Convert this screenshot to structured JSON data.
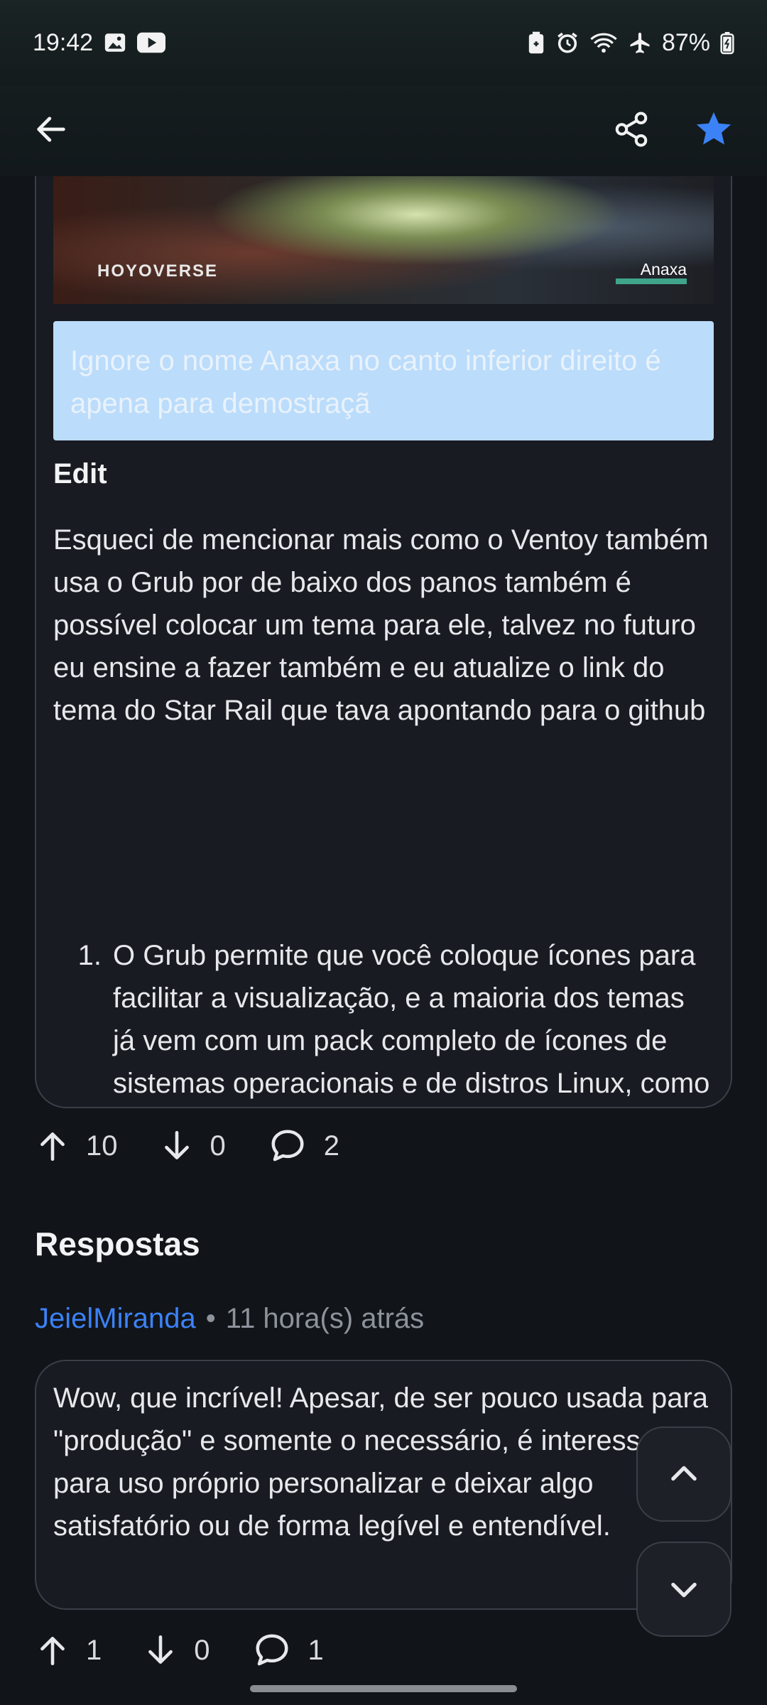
{
  "status_bar": {
    "time": "19:42",
    "battery": "87%",
    "icons": [
      "image-icon",
      "youtube-icon",
      "battery-saver-icon",
      "alarm-icon",
      "wifi-icon",
      "airplane-icon",
      "battery-icon"
    ]
  },
  "app_bar": {
    "icons": [
      "back-arrow-icon",
      "share-icon",
      "star-icon"
    ],
    "accent": "#3b82f6"
  },
  "post": {
    "image_watermark": "HOYOVERSE",
    "image_tag": "Anaxa",
    "callout_text": "Ignore o nome Anaxa no canto inferior direito é apena para demostraçã",
    "edit_heading": "Edit",
    "body": "Esqueci de mencionar mais como o Ventoy também usa o Grub por de baixo dos panos também é possível colocar um tema para ele, talvez no futuro eu ensine a fazer também e eu atualize o link do tema do Star Rail que tava apontando para o github",
    "list": [
      {
        "number": "1.",
        "text": "O Grub permite que você coloque ícones para facilitar a visualização, e a maioria dos temas já vem com um pack completo de ícones de sistemas operacionais e de distros Linux, como você pode ver na imagem do começo."
      }
    ],
    "upvotes": "10",
    "downvotes": "0",
    "comments": "2"
  },
  "replies": {
    "title": "Respostas",
    "items": [
      {
        "author": "JeielMiranda",
        "separator": "•",
        "time": "11 hora(s) atrás",
        "text": "Wow, que incrível! Apesar, de ser pouco usada para \"produção\" e somente o necessário, é interessante para uso próprio personalizar e deixar algo satisfatório ou de forma legível e entendível.",
        "upvotes": "1",
        "downvotes": "0",
        "comments": "1"
      }
    ]
  },
  "fabs": {
    "icons": [
      "chevron-up-icon",
      "chevron-down-icon"
    ]
  }
}
